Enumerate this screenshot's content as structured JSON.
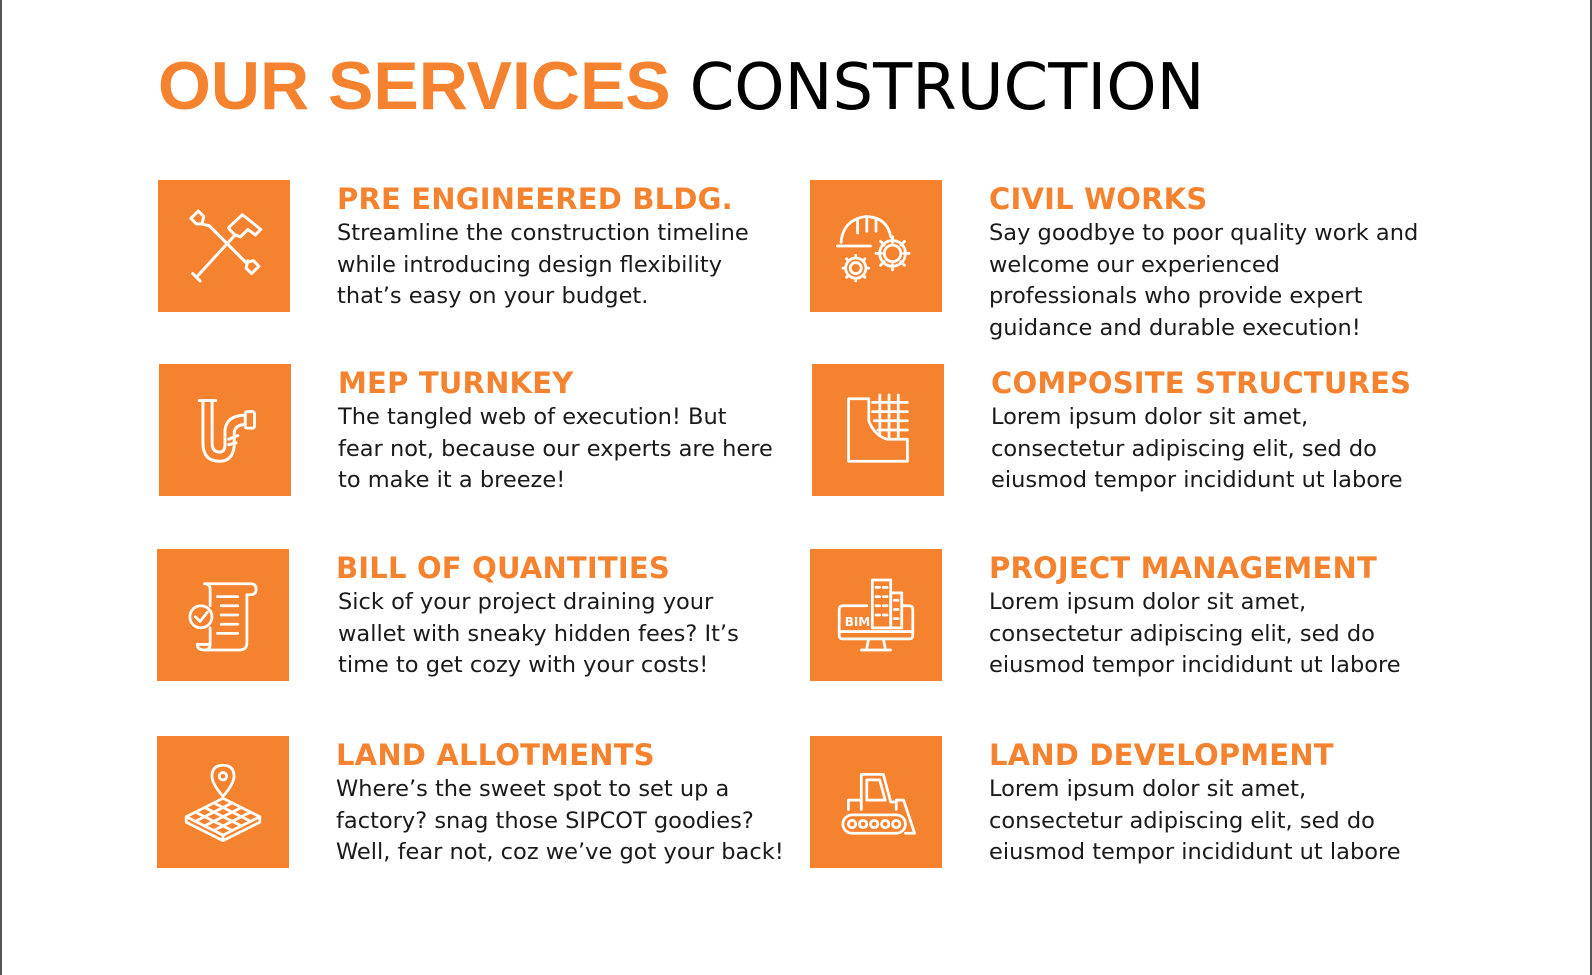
{
  "header": {
    "title_accent": "OUR SERVICES",
    "title_main": "CONSTRUCTION"
  },
  "colors": {
    "accent": "#f5822f",
    "text": "#1a1a1a"
  },
  "services": [
    {
      "icon": "tools-icon",
      "title": "PRE ENGINEERED BLDG.",
      "description": "Streamline the construction timeline\nwhile introducing design flexibility\nthat’s easy on your budget."
    },
    {
      "icon": "helmet-gears-icon",
      "title": "CIVIL WORKS",
      "description": "Say goodbye to poor quality work and\nwelcome our experienced\nprofessionals who provide expert\nguidance and durable execution!"
    },
    {
      "icon": "pipe-icon",
      "title": "MEP TURNKEY",
      "description": "The tangled web of execution! But\nfear not, because our experts are here\nto make it a breeze!"
    },
    {
      "icon": "structure-grid-icon",
      "title": "COMPOSITE STRUCTURES",
      "description": "Lorem ipsum dolor sit amet,\nconsectetur adipiscing elit, sed do\neiusmod tempor incididunt ut labore"
    },
    {
      "icon": "bill-scroll-icon",
      "title": "BILL OF QUANTITIES",
      "description": "Sick of your project draining your\nwallet with sneaky hidden fees? It’s\ntime to get cozy with your costs!"
    },
    {
      "icon": "bim-monitor-icon",
      "icon_label": "BIM",
      "title": "PROJECT MANAGEMENT",
      "description": "Lorem ipsum dolor sit amet,\nconsectetur adipiscing elit, sed do\neiusmod tempor incididunt ut labore"
    },
    {
      "icon": "land-pin-icon",
      "title": "LAND ALLOTMENTS",
      "description": "Where’s the sweet spot to set up a\nfactory? snag those SIPCOT goodies?\nWell, fear not, coz we’ve got your back!"
    },
    {
      "icon": "bulldozer-icon",
      "title": "LAND DEVELOPMENT",
      "description": "Lorem ipsum dolor sit amet,\nconsectetur adipiscing elit, sed do\neiusmod tempor incididunt ut labore"
    }
  ]
}
